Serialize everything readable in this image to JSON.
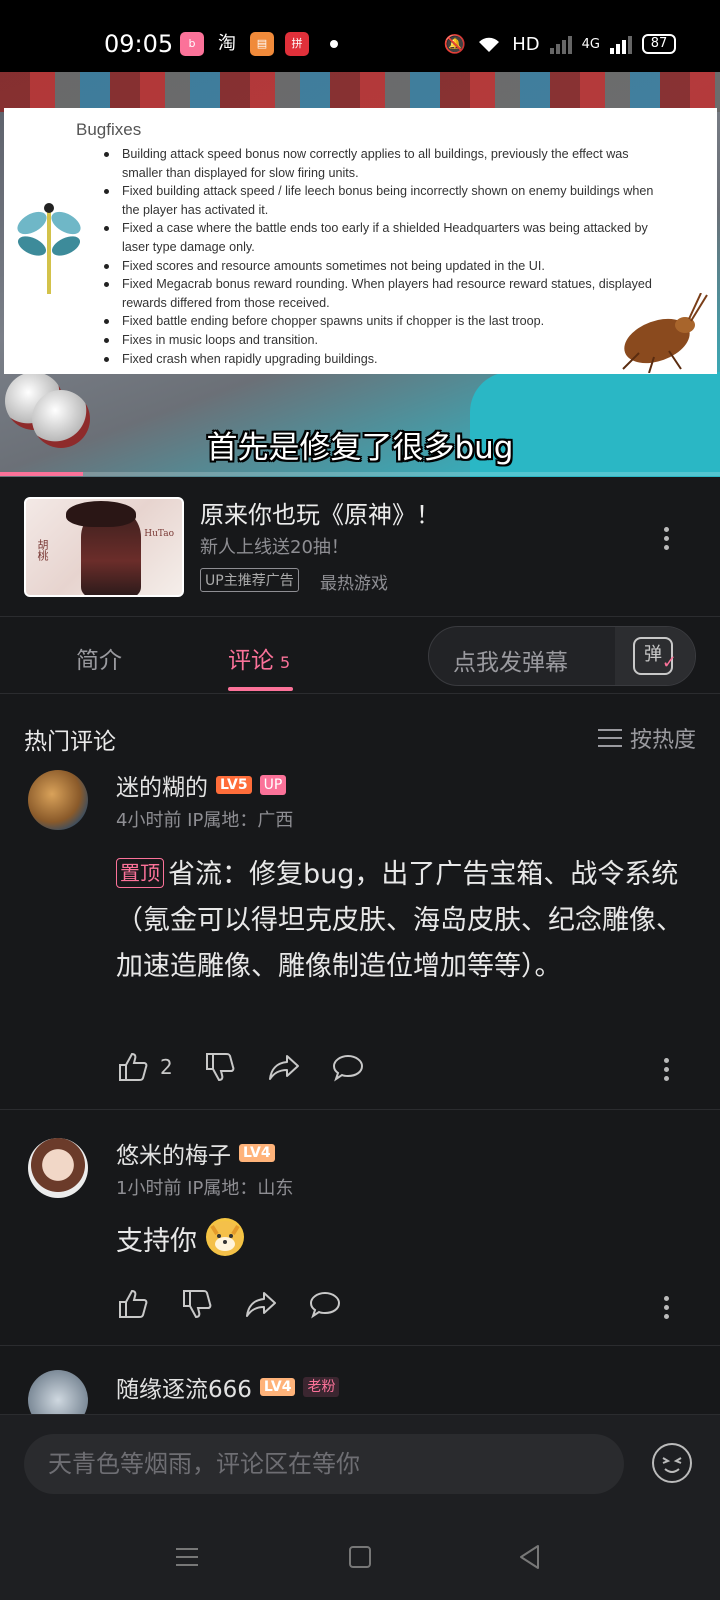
{
  "status_bar": {
    "time": "09:05",
    "apps": [
      "bilibili",
      "淘",
      "books",
      "拼"
    ],
    "network": "HD",
    "signal": "4G",
    "battery": "87"
  },
  "video": {
    "slide_title": "Bugfixes",
    "slide_items": [
      "Building attack speed bonus now correctly applies to all buildings, previously the effect was smaller than displayed for slow firing units.",
      "Fixed building attack speed / life leech bonus being incorrectly shown on enemy buildings when the player has activated it.",
      "Fixed a case where the battle ends too early if a shielded Headquarters was being attacked by laser type damage only.",
      "Fixed scores and resource amounts sometimes not being updated in the UI.",
      "Fixed Megacrab bonus reward rounding. When players had resource reward statues, displayed rewards differed from those received.",
      "Fixed battle ending before chopper spawns units if chopper is the last troop.",
      "Fixes in music loops and transition.",
      "Fixed crash when rapidly upgrading buildings."
    ],
    "subtitle": "首先是修复了很多bug",
    "progress": 0.115
  },
  "ad": {
    "thumb_text_1": "胡桃",
    "thumb_text_2": "HuTao",
    "title": "原来你也玩《原神》！",
    "subtitle": "新人上线送20抽！",
    "badge": "UP主推荐广告",
    "tag": "最热游戏"
  },
  "tabs": {
    "intro": "简介",
    "comments": "评论",
    "comment_count": "5",
    "danmaku_placeholder": "点我发弹幕",
    "danmaku_icon": "弹"
  },
  "comments_section": {
    "title": "热门评论",
    "sort_label": "按热度",
    "comments": [
      {
        "user": "迷的糊的",
        "level": "LV5",
        "badge": "UP",
        "meta": "4小时前  IP属地：广西",
        "pinned": "置顶",
        "text": "省流：修复bug，出了广告宝箱、战令系统（氪金可以得坦克皮肤、海岛皮肤、纪念雕像、加速造雕像、雕像制造位增加等等）。",
        "likes": "2"
      },
      {
        "user": "悠米的梅子",
        "level": "LV4",
        "meta": "1小时前  IP属地：山东",
        "text": "支持你",
        "emoji": "doge-emoji"
      },
      {
        "user": "随缘逐流666",
        "level": "LV4",
        "badge": "老粉"
      }
    ]
  },
  "input": {
    "placeholder": "天青色等烟雨，评论区在等你"
  },
  "colors": {
    "accent": "#fb7299",
    "background": "#17181a",
    "muted": "#8e8e93"
  }
}
